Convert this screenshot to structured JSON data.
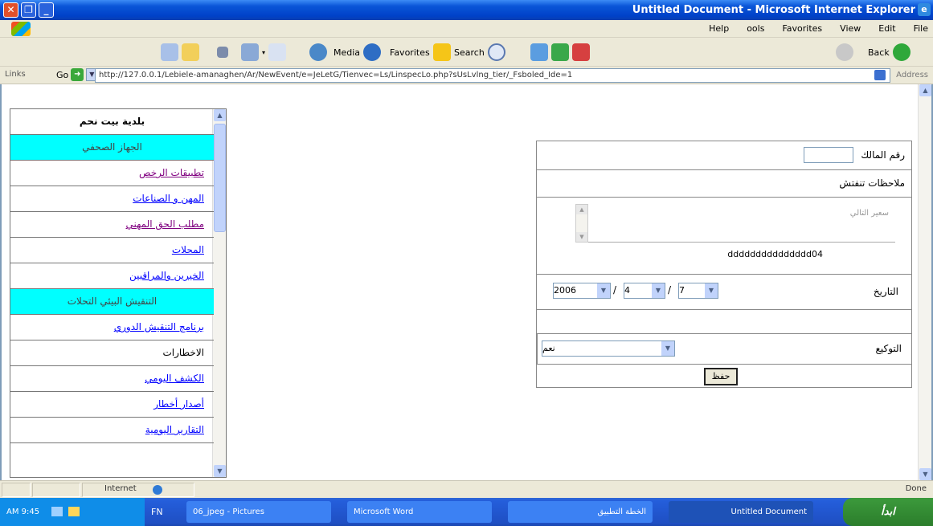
{
  "window": {
    "title": "Untitled Document - Microsoft Internet Explorer"
  },
  "menubar": {
    "items": [
      "Help",
      "ools",
      "Favorites",
      "View",
      "Edit",
      "File"
    ]
  },
  "toolbar": {
    "media": "Media",
    "favorites": "Favorites",
    "search": "Search",
    "back": "Back"
  },
  "address": {
    "links": "Links",
    "go": "Go",
    "url": "http://127.0.0.1/Lebiele-amanaghen/Ar/NewEvent/e=JeLetG/Tienvec=Ls/LinspecLo.php?sUsLvlng_tier/_Fsboled_Ide=1",
    "label": "Address"
  },
  "menu": {
    "items": [
      {
        "label": "بلدية بيت نحم",
        "style": "title"
      },
      {
        "label": "الجهاز الصحفي",
        "style": "header"
      },
      {
        "label": "تطبيقات الرخص",
        "style": "visited"
      },
      {
        "label": "المهن و الصناعات",
        "style": "link"
      },
      {
        "label": "مطلب الحق المهني",
        "style": "visited"
      },
      {
        "label": "المحلات",
        "style": "link"
      },
      {
        "label": "الخيرين والمراقبين",
        "style": "link"
      },
      {
        "label": "التنقيش البيئي التحلات",
        "style": "header"
      },
      {
        "label": "برنامج التنقيش الدوري",
        "style": "link"
      },
      {
        "label": "الاخطارات",
        "style": "plain"
      },
      {
        "label": "الكشف اليومي",
        "style": "link"
      },
      {
        "label": "أصدار أخطار",
        "style": "link"
      },
      {
        "label": "التقارير اليومية",
        "style": "link"
      }
    ]
  },
  "form": {
    "code_label": "رقم المالك",
    "notes_label": "ملاحظات تنفتش",
    "textarea_text": "سعير التالي",
    "notes_value": "ddddddddddddddd04",
    "date_label": "التاريخ",
    "year": "2006",
    "month": "4",
    "day": "7",
    "select_label": "التوكيع",
    "select_value": "نعم",
    "save": "حفظ"
  },
  "status": {
    "zone": "Internet",
    "done": "Done"
  },
  "taskbar": {
    "start": "ابدأ",
    "tray_time": "AM 9:45",
    "fn": "FN",
    "tasks": [
      "06_jpeg - Pictures",
      "Microsoft Word",
      "الخطة التطبيق",
      "Untitled Document"
    ]
  }
}
